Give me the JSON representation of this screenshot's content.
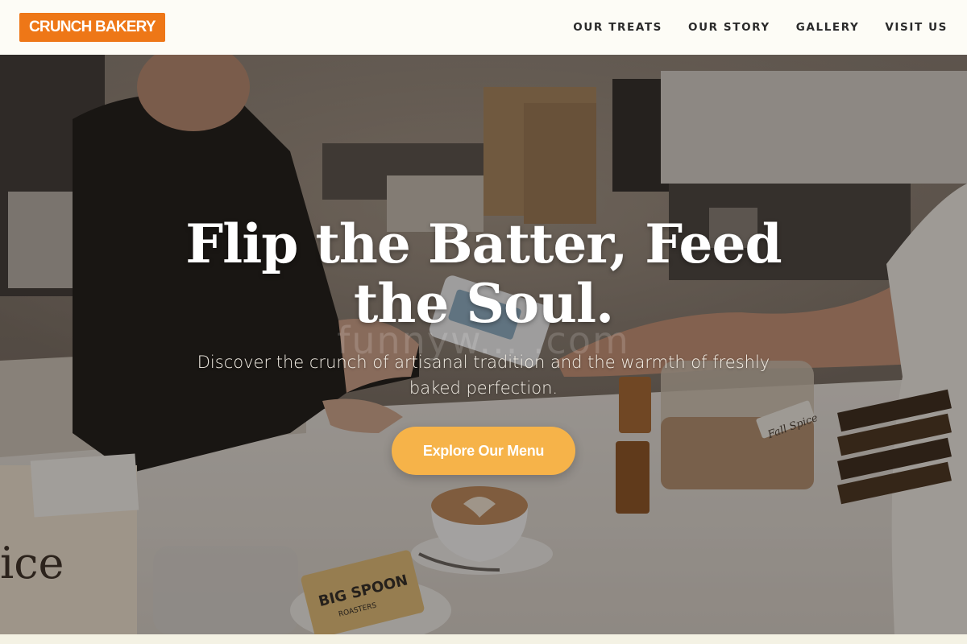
{
  "header": {
    "logo_text": "CRUNCH BAKERY",
    "nav": [
      {
        "label": "OUR TREATS"
      },
      {
        "label": "OUR STORY"
      },
      {
        "label": "GALLERY"
      },
      {
        "label": "VISIT US"
      }
    ]
  },
  "hero": {
    "title": "Flip the Batter, Feed the Soul.",
    "subtitle": "Discover the crunch of artisanal tradition and the warmth of freshly baked perfection.",
    "cta_label": "Explore Our Menu",
    "watermark": "funnyw... .com"
  },
  "photo_labels": {
    "spice_jar": "Fall Spice",
    "bag_brand": "BIG SPOON",
    "bag_sub": "ROASTERS",
    "sign_script": "ice"
  },
  "colors": {
    "brand_orange": "#ee7717",
    "cta_yellow": "#f6b349",
    "header_bg": "#fdfcf6",
    "nav_text": "#2a2a2a"
  }
}
